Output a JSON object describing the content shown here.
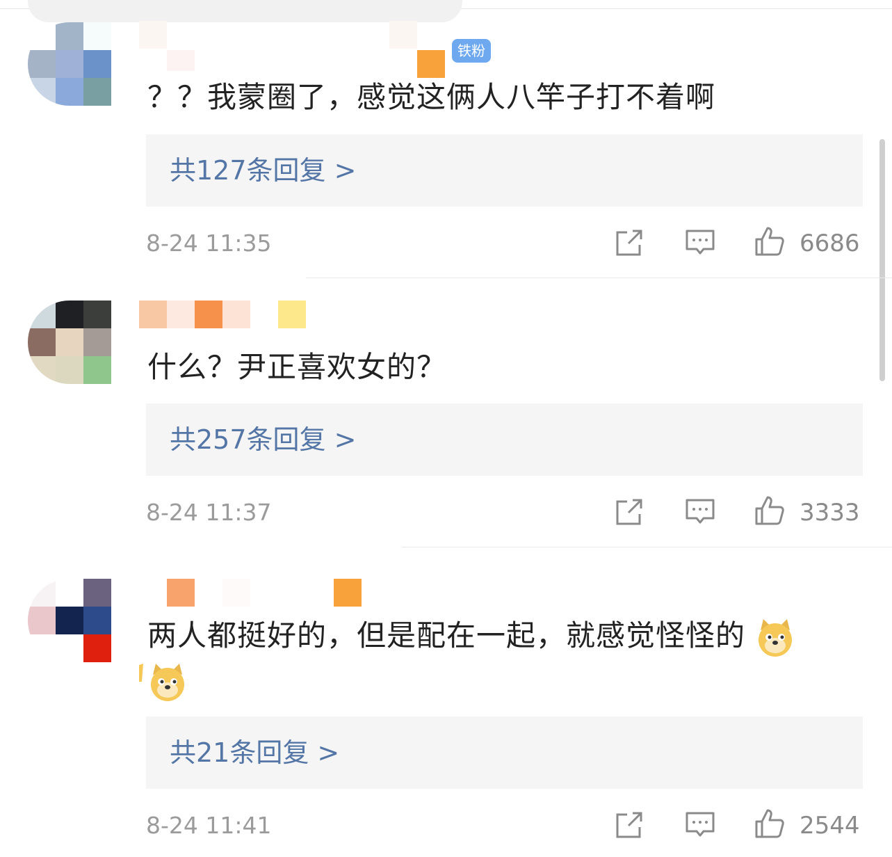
{
  "comments": [
    {
      "badge": "铁粉",
      "text": "？？我蒙圈了，感觉这俩人八竿子打不着啊",
      "replies_label": "共127条回复 >",
      "time": "8-24 11:35",
      "likes": "6686",
      "avatar_colors": [
        "#ffffff",
        "#a2b4c7",
        "#f6fbfb",
        "#a4b3c6",
        "#9fb1d7",
        "#6b93c9",
        "#c8d5e6",
        "#8ba9da",
        "#7a9fa2"
      ]
    },
    {
      "text": "什么？尹正喜欢女的？",
      "replies_label": "共257条回复 >",
      "time": "8-24 11:37",
      "likes": "3333",
      "avatar_colors": [
        "#cfdadf",
        "#1e2024",
        "#3b3e3a",
        "#8a6c62",
        "#e8d5bf",
        "#a59b96",
        "#e1d9c2",
        "#dcd8c0",
        "#8fc68c"
      ]
    },
    {
      "text": "两人都挺好的，但是配在一起，就感觉怪怪的",
      "replies_label": "共21条回复 >",
      "time": "8-24 11:41",
      "likes": "2544",
      "avatar_colors": [
        "#f7f3f4",
        "#ffffff",
        "#6b6280",
        "#e9c7cb",
        "#13244e",
        "#2d4b8a",
        "#ffffff",
        "#ffffff",
        "#e0200f"
      ]
    }
  ],
  "icons": {
    "share": "share-icon",
    "comment": "comment-icon",
    "like": "thumbs-up-icon",
    "emoji": "doge-emoji-icon"
  }
}
